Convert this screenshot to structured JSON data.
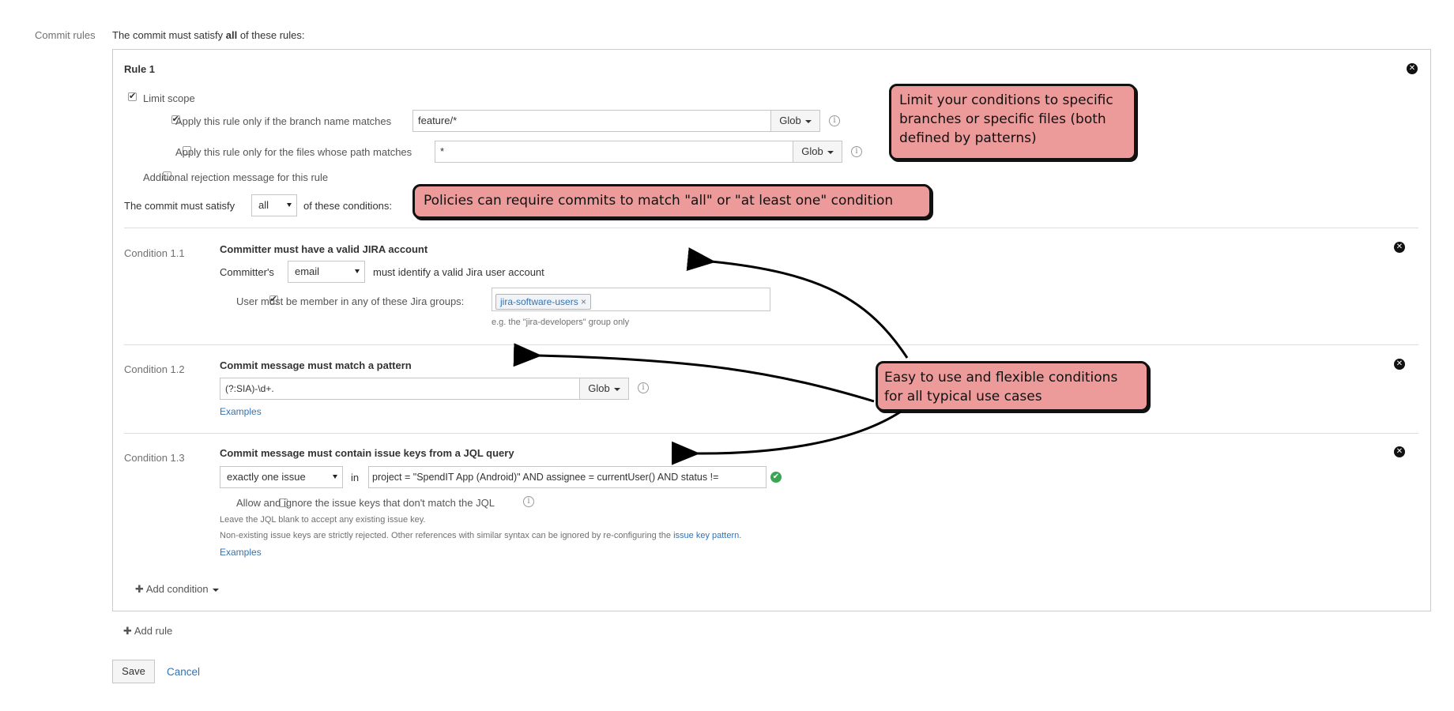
{
  "header": {
    "label": "Commit rules",
    "intro_prefix": "The commit must satisfy ",
    "intro_bold": "all",
    "intro_suffix": " of these rules:"
  },
  "rule": {
    "title": "Rule 1",
    "limit_scope_label": "Limit scope",
    "branch": {
      "label": "Apply this rule only if the branch name matches",
      "value": "feature/*",
      "mode": "Glob"
    },
    "files": {
      "label": "Apply this rule only for the files whose path matches",
      "value": "*",
      "mode": "Glob"
    },
    "rejection_label": "Additional rejection message for this rule",
    "satisfy_prefix": "The commit must satisfy",
    "satisfy_value": "all",
    "satisfy_suffix": "of these conditions:"
  },
  "conditions": [
    {
      "id": "Condition 1.1",
      "title": "Committer must have a valid JIRA account",
      "prefix": "Committer's",
      "select_value": "email",
      "suffix": "must identify a valid Jira user account",
      "groups_label": "User must be member in any of these Jira groups:",
      "group_tag": "jira-software-users",
      "hint": "e.g. the \"jira-developers\" group only"
    },
    {
      "id": "Condition 1.2",
      "title": "Commit message must match a pattern",
      "pattern": "(?:SIA)-\\d+.",
      "mode": "Glob",
      "examples": "Examples"
    },
    {
      "id": "Condition 1.3",
      "title": "Commit message must contain issue keys from a JQL query",
      "select_value": "exactly one issue",
      "in_label": "in",
      "jql": "project = \"SpendIT App (Android)\" AND assignee = currentUser() AND status !=",
      "allow_label": "Allow and ignore the issue keys that don't match the JQL",
      "note1": "Leave the JQL blank to accept any existing issue key.",
      "note2_prefix": "Non-existing issue keys are strictly rejected. Other references with similar syntax can be ignored by re-configuring the ",
      "note2_link": "issue key pattern",
      "note2_suffix": ".",
      "examples": "Examples"
    }
  ],
  "add_condition": "Add condition",
  "add_rule": "Add rule",
  "save_label": "Save",
  "cancel_label": "Cancel",
  "callouts": {
    "scope": "Limit your conditions to specific branches or specific files (both defined by patterns)",
    "policy": "Policies can require commits to match \"all\" or \"at least one\" condition",
    "conditions": "Easy to use and flexible conditions for all typical use cases"
  },
  "colors": {
    "link": "#3572b0",
    "callout_bg": "#ec9a9a",
    "success": "#3aa655"
  }
}
